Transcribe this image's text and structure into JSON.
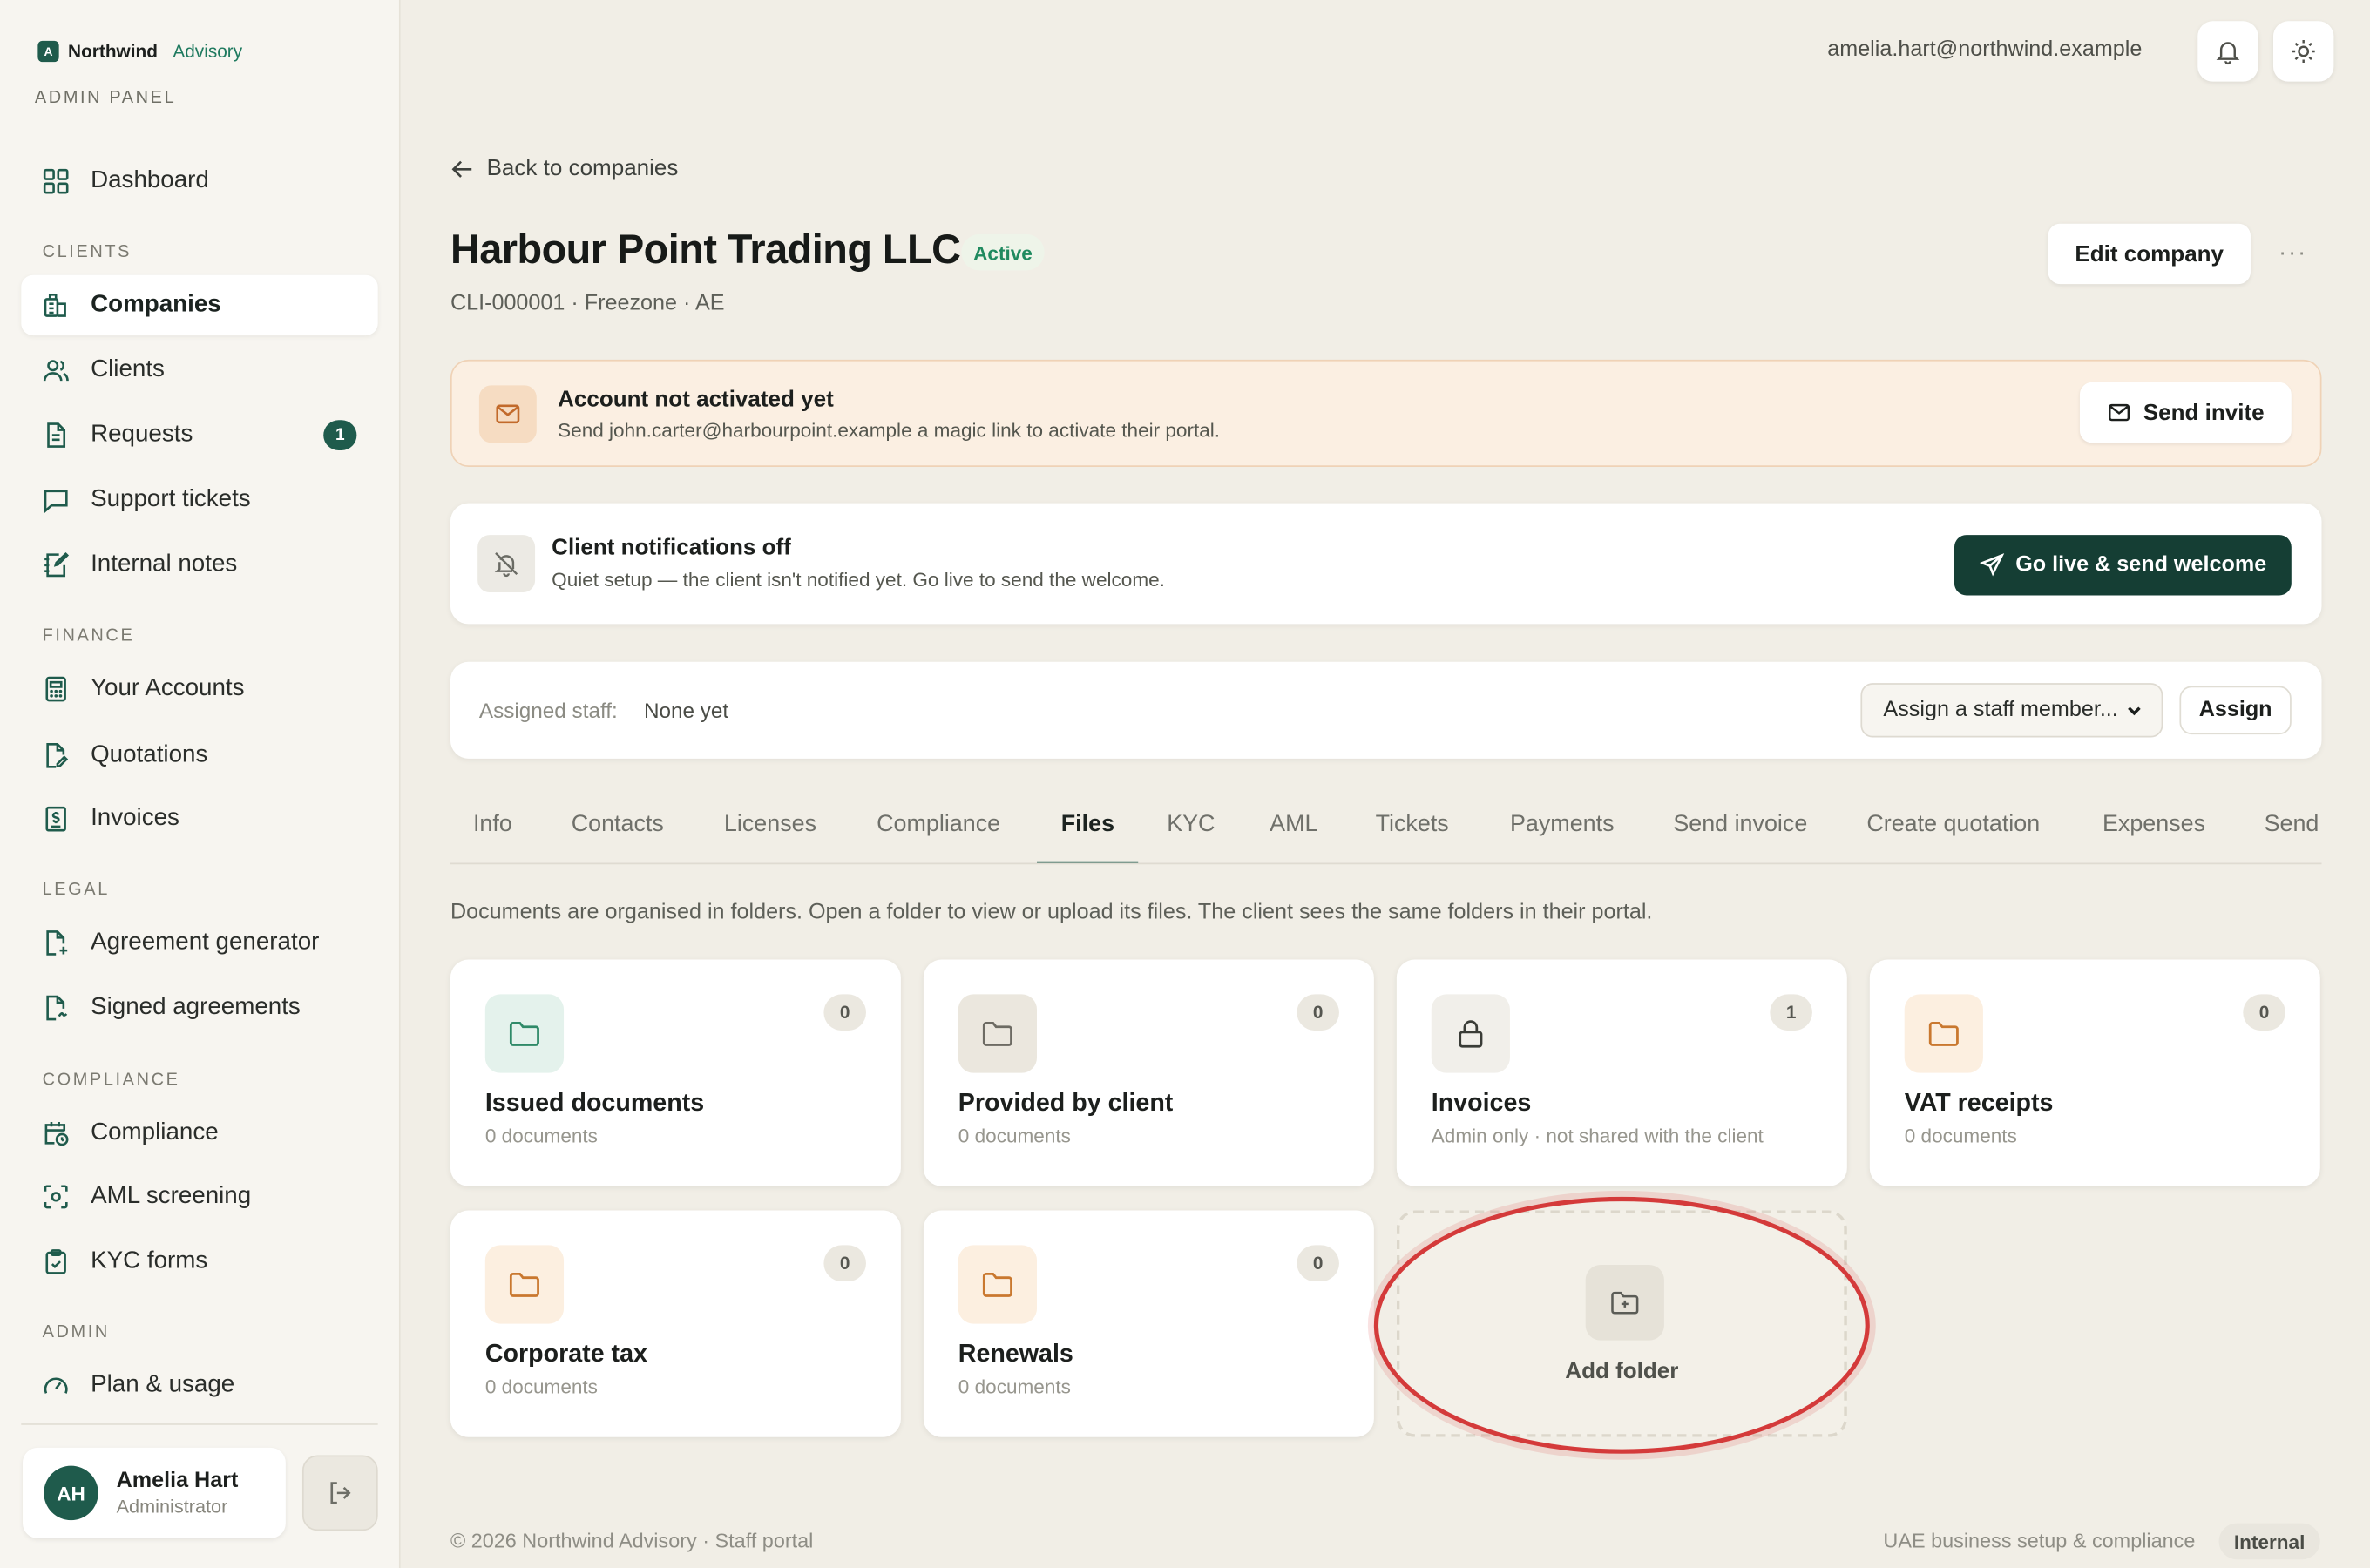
{
  "brand": {
    "logo_letter": "A",
    "name": "Northwind",
    "sub": "Advisory",
    "panel_label": "ADMIN PANEL"
  },
  "topbar": {
    "user_email": "amelia.hart@northwind.example"
  },
  "sidebar": {
    "dashboard": "Dashboard",
    "sections": {
      "clients": "CLIENTS",
      "finance": "FINANCE",
      "legal": "LEGAL",
      "compliance": "COMPLIANCE",
      "admin": "ADMIN"
    },
    "items": {
      "companies": "Companies",
      "clients": "Clients",
      "requests": "Requests",
      "requests_badge": "1",
      "support_tickets": "Support tickets",
      "internal_notes": "Internal notes",
      "your_accounts": "Your Accounts",
      "quotations": "Quotations",
      "invoices": "Invoices",
      "agreement_generator": "Agreement generator",
      "signed_agreements": "Signed agreements",
      "compliance": "Compliance",
      "aml_screening": "AML screening",
      "kyc_forms": "KYC forms",
      "plan_usage": "Plan & usage"
    },
    "user": {
      "initials": "AH",
      "name": "Amelia Hart",
      "role": "Administrator"
    }
  },
  "main": {
    "back_label": "Back to companies",
    "company_name": "Harbour Point Trading LLC",
    "status": "Active",
    "meta": "CLI-000001 · Freezone · AE",
    "edit_label": "Edit company",
    "more_label": "···",
    "activation_banner": {
      "title": "Account not activated yet",
      "description": "Send john.carter@harbourpoint.example a magic link to activate their portal.",
      "button": "Send invite"
    },
    "notifications_banner": {
      "title": "Client notifications off",
      "description": "Quiet setup — the client isn't notified yet. Go live to send the welcome.",
      "button": "Go live & send welcome"
    },
    "staff": {
      "label": "Assigned staff:",
      "value": "None yet",
      "select_value": "Assign a staff member...",
      "assign_button": "Assign"
    },
    "tabs": [
      "Info",
      "Contacts",
      "Licenses",
      "Compliance",
      "Files",
      "KYC",
      "AML",
      "Tickets",
      "Payments",
      "Send invoice",
      "Create quotation",
      "Expenses",
      "Send"
    ],
    "active_tab": "Files",
    "files_description": "Documents are organised in folders. Open a folder to view or upload its files. The client sees the same folders in their portal.",
    "folders": [
      {
        "name": "Issued documents",
        "sub": "0 documents",
        "count": "0",
        "icon": "folder-icon",
        "accent": "#e4f2ec"
      },
      {
        "name": "Provided by client",
        "sub": "0 documents",
        "count": "0",
        "icon": "folder-icon",
        "accent": "#ebe7de"
      },
      {
        "name": "Invoices",
        "sub": "Admin only · not shared with the client",
        "count": "1",
        "icon": "lock-icon",
        "accent": "#f1efea"
      },
      {
        "name": "VAT receipts",
        "sub": "0 documents",
        "count": "0",
        "icon": "folder-icon",
        "accent": "#fcefe0"
      },
      {
        "name": "Corporate tax",
        "sub": "0 documents",
        "count": "0",
        "icon": "folder-icon",
        "accent": "#fcefe0"
      },
      {
        "name": "Renewals",
        "sub": "0 documents",
        "count": "0",
        "icon": "folder-icon",
        "accent": "#fcefe0"
      }
    ],
    "add_folder_label": "Add folder"
  },
  "footer": {
    "left": "© 2026 Northwind Advisory · Staff portal",
    "right": "UAE business setup & compliance",
    "pill": "Internal"
  },
  "colors": {
    "brand": "#1f5b4c",
    "primary_button": "#153e34",
    "warning_bg": "#fbefe2",
    "highlight": "#d43a3a"
  }
}
